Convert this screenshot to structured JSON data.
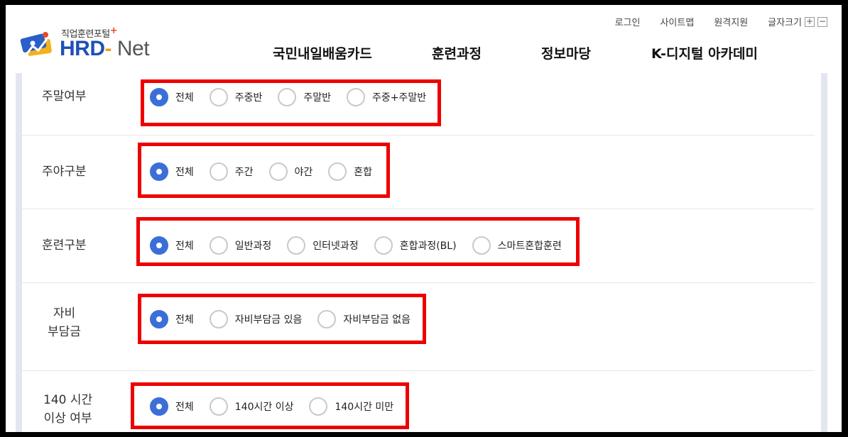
{
  "header": {
    "logo": {
      "subtitle": "직업훈련포털",
      "plus": "+",
      "brand_hrd": "HRD",
      "brand_dash": "-",
      "brand_net": "Net"
    },
    "util_links": [
      "로그인",
      "사이트맵",
      "원격지원"
    ],
    "font_size_label": "글자크기",
    "font_plus": "+",
    "font_minus": "−",
    "nav": [
      "국민내일배움카드",
      "훈련과정",
      "정보마당",
      "K-디지털 아카데미"
    ]
  },
  "filters": [
    {
      "label": "주말여부",
      "options": [
        "전체",
        "주중반",
        "주말반",
        "주중+주말반"
      ],
      "selected": 0
    },
    {
      "label": "주야구분",
      "options": [
        "전체",
        "주간",
        "야간",
        "혼합"
      ],
      "selected": 0
    },
    {
      "label": "훈련구분",
      "options": [
        "전체",
        "일반과정",
        "인터넷과정",
        "혼합과정(BL)",
        "스마트혼합훈련"
      ],
      "selected": 0
    },
    {
      "label_lines": [
        "자비",
        "부담금"
      ],
      "options": [
        "전체",
        "자비부담금 있음",
        "자비부담금 없음"
      ],
      "selected": 0
    },
    {
      "label_lines": [
        "140 시간",
        "이상 여부"
      ],
      "options": [
        "전체",
        "140시간 이상",
        "140시간 미만"
      ],
      "selected": 0
    }
  ],
  "colors": {
    "accent": "#3b6fd8",
    "highlight": "#ee0000",
    "brand_blue": "#1e4fb8",
    "brand_orange": "#f39a1e"
  }
}
